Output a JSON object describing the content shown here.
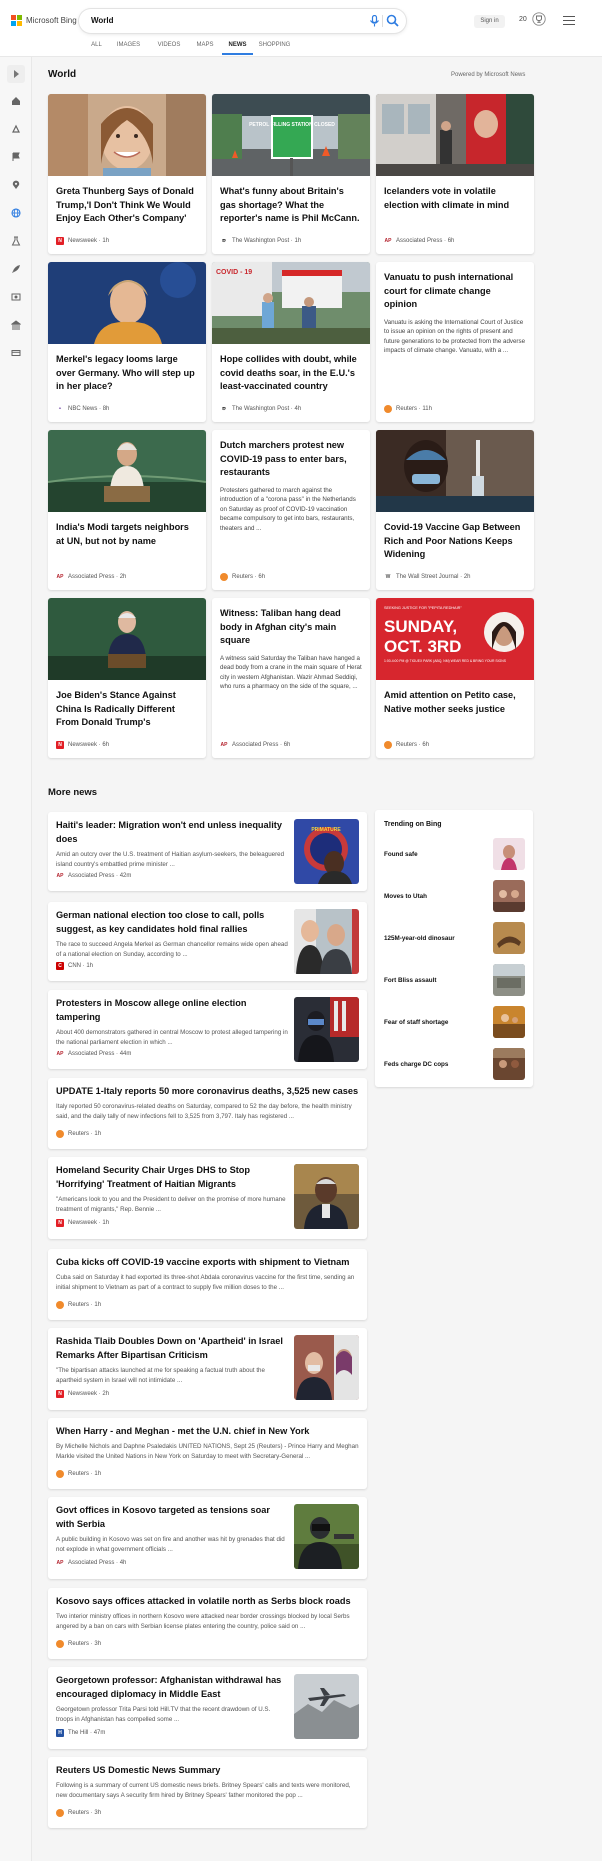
{
  "header": {
    "brand": "Microsoft Bing",
    "search_query": "World",
    "signin": "Sign in",
    "points": "20"
  },
  "nav": [
    "ALL",
    "IMAGES",
    "VIDEOS",
    "MAPS",
    "NEWS",
    "SHOPPING"
  ],
  "nav_active": "NEWS",
  "world": {
    "title": "World",
    "powered_by": "Powered by Microsoft News",
    "cards": [
      {
        "headline": "Greta Thunberg Says of Donald Trump,'I Don't Think We Would Enjoy Each Other's Company'",
        "source": "Newsweek",
        "time": "1h"
      },
      {
        "headline": "What's funny about Britain's gas shortage? What the reporter's name is Phil McCann.",
        "source": "The Washington Post",
        "time": "1h",
        "image_text": "PETROL FILLING STATION CLOSED"
      },
      {
        "headline": "Icelanders vote in volatile election with climate in mind",
        "source": "Associated Press",
        "time": "6h"
      },
      {
        "headline": "Merkel's legacy looms large over Germany. Who will step up in her place?",
        "source": "NBC News",
        "time": "8h"
      },
      {
        "headline": "Hope collides with doubt, while covid deaths soar, in the E.U.'s least-vaccinated country",
        "source": "The Washington Post",
        "time": "4h",
        "image_text": "COVID - 19"
      },
      {
        "headline": "Vanuatu to push international court for climate change opinion",
        "snippet": "Vanuatu is asking the International Court of Justice to issue an opinion on the rights of present and future generations to be protected from the adverse impacts of climate change. Vanuatu, with a ...",
        "source": "Reuters",
        "time": "11h"
      },
      {
        "headline": "India's Modi targets neighbors at UN, but not by name",
        "source": "Associated Press",
        "time": "2h"
      },
      {
        "headline": "Dutch marchers protest new COVID-19 pass to enter bars, restaurants",
        "snippet": "Protesters gathered to march against the introduction of a \"corona pass\" in the Netherlands on Saturday as proof of COVID-19 vaccination became compulsory to get into bars, restaurants, theaters and ...",
        "source": "Reuters",
        "time": "6h"
      },
      {
        "headline": "Covid-19 Vaccine Gap Between Rich and Poor Nations Keeps Widening",
        "source": "The Wall Street Journal",
        "time": "2h"
      },
      {
        "headline": "Joe Biden's Stance Against China Is Radically Different From Donald Trump's",
        "source": "Newsweek",
        "time": "6h"
      },
      {
        "headline": "Witness: Taliban hang dead body in Afghan city's main square",
        "snippet": "A witness said Saturday the Taliban have hanged a dead body from a crane in the main square of Herat city in western Afghanistan. Wazir Ahmad Seddiqi, who runs a pharmacy on the side of the square, ...",
        "source": "Associated Press",
        "time": "6h"
      },
      {
        "headline": "Amid attention on Petito case, Native mother seeks justice",
        "source": "Reuters",
        "time": "6h",
        "image_text_top": "SEEKING JUSTICE FOR \"PEPITA REDHAIR\"",
        "image_text_big1": "SUNDAY,",
        "image_text_big2": "OCT. 3RD",
        "image_text_small": "1:00-4:00 PM @ TIGUEX PARK (ABQ, NM) WEAR RED & BRING YOUR SIGNS"
      }
    ]
  },
  "more": {
    "title": "More news",
    "items": [
      {
        "headline": "Haiti's leader: Migration won't end unless inequality does",
        "snippet": "Amid an outcry over the U.S. treatment of Haitian asylum-seekers, the beleaguered island country's embattled prime minister ...",
        "source": "Associated Press",
        "time": "42m",
        "image_text": "PRIMATURE"
      },
      {
        "headline": "German national election too close to call, polls suggest, as key candidates hold final rallies",
        "snippet": "The race to succeed Angela Merkel as German chancellor remains wide open ahead of a national election on Sunday, according to ...",
        "source": "CNN",
        "time": "1h"
      },
      {
        "headline": "Protesters in Moscow allege online election tampering",
        "snippet": "About 400 demonstrators gathered in central Moscow to protest alleged tampering in the national parliament election in which ...",
        "source": "Associated Press",
        "time": "44m"
      },
      {
        "headline": "UPDATE 1-Italy reports 50 more coronavirus deaths, 3,525 new cases",
        "snippet": "Italy reported 50 coronavirus-related deaths on Saturday, compared to 52 the day before, the health ministry said, and the daily tally of new infections fell to 3,525 from 3,797. Italy has registered ...",
        "source": "Reuters",
        "time": "1h"
      },
      {
        "headline": "Homeland Security Chair Urges DHS to Stop 'Horrifying' Treatment of Haitian Migrants",
        "snippet": "\"Americans look to you and the President to deliver on the promise of more humane treatment of migrants,\" Rep. Bennie ...",
        "source": "Newsweek",
        "time": "1h"
      },
      {
        "headline": "Cuba kicks off COVID-19 vaccine exports with shipment to Vietnam",
        "snippet": "Cuba said on Saturday it had exported its three-shot Abdala coronavirus vaccine for the first time, sending an initial shipment to Vietnam as part of a contract to supply five million doses to the ...",
        "source": "Reuters",
        "time": "1h"
      },
      {
        "headline": "Rashida Tlaib Doubles Down on 'Apartheid' in Israel Remarks After Bipartisan Criticism",
        "snippet": "\"The bipartisan attacks launched at me for speaking a factual truth about the apartheid system in Israel will not intimidate ...",
        "source": "Newsweek",
        "time": "2h"
      },
      {
        "headline": "When Harry - and Meghan - met the U.N. chief in New York",
        "snippet": "By Michelle Nichols and Daphne Psaledakis UNITED NATIONS, Sept 25 (Reuters) - Prince Harry and Meghan Markle visited the United Nations in New York on Saturday to meet with Secretary-General ...",
        "source": "Reuters",
        "time": "1h"
      },
      {
        "headline": "Govt offices in Kosovo targeted as tensions soar with Serbia",
        "snippet": "A public building in Kosovo was set on fire and another was hit by grenades that did not explode in what government officials ...",
        "source": "Associated Press",
        "time": "4h"
      },
      {
        "headline": "Kosovo says offices attacked in volatile north as Serbs block roads",
        "snippet": "Two interior ministry offices in northern Kosovo were attacked near border crossings blocked by local Serbs angered by a ban on cars with Serbian license plates entering the country, police said on ...",
        "source": "Reuters",
        "time": "3h"
      },
      {
        "headline": "Georgetown professor: Afghanistan withdrawal has encouraged diplomacy in Middle East",
        "snippet": "Georgetown professor Trita Parsi told Hill.TV that the recent drawdown of U.S. troops in Afghanistan has compelled some ...",
        "source": "The Hill",
        "time": "47m"
      },
      {
        "headline": "Reuters US Domestic News Summary",
        "snippet": "Following is a summary of current US domestic news briefs. Britney Spears' calls and texts were monitored, new documentary says A security firm hired by Britney Spears' father monitored the pop ...",
        "source": "Reuters",
        "time": "3h"
      }
    ]
  },
  "trending": {
    "title": "Trending on Bing",
    "items": [
      "Found safe",
      "Moves to Utah",
      "125M-year-old dinosaur",
      "Fort Bliss assault",
      "Fear of staff shortage",
      "Feds charge DC cops"
    ]
  },
  "colors": {
    "accent": "#2f7de1",
    "newsweek": "#e21f26",
    "ap": "#b3202b",
    "reuters": "#f08a2c",
    "wapo": "#222222"
  }
}
